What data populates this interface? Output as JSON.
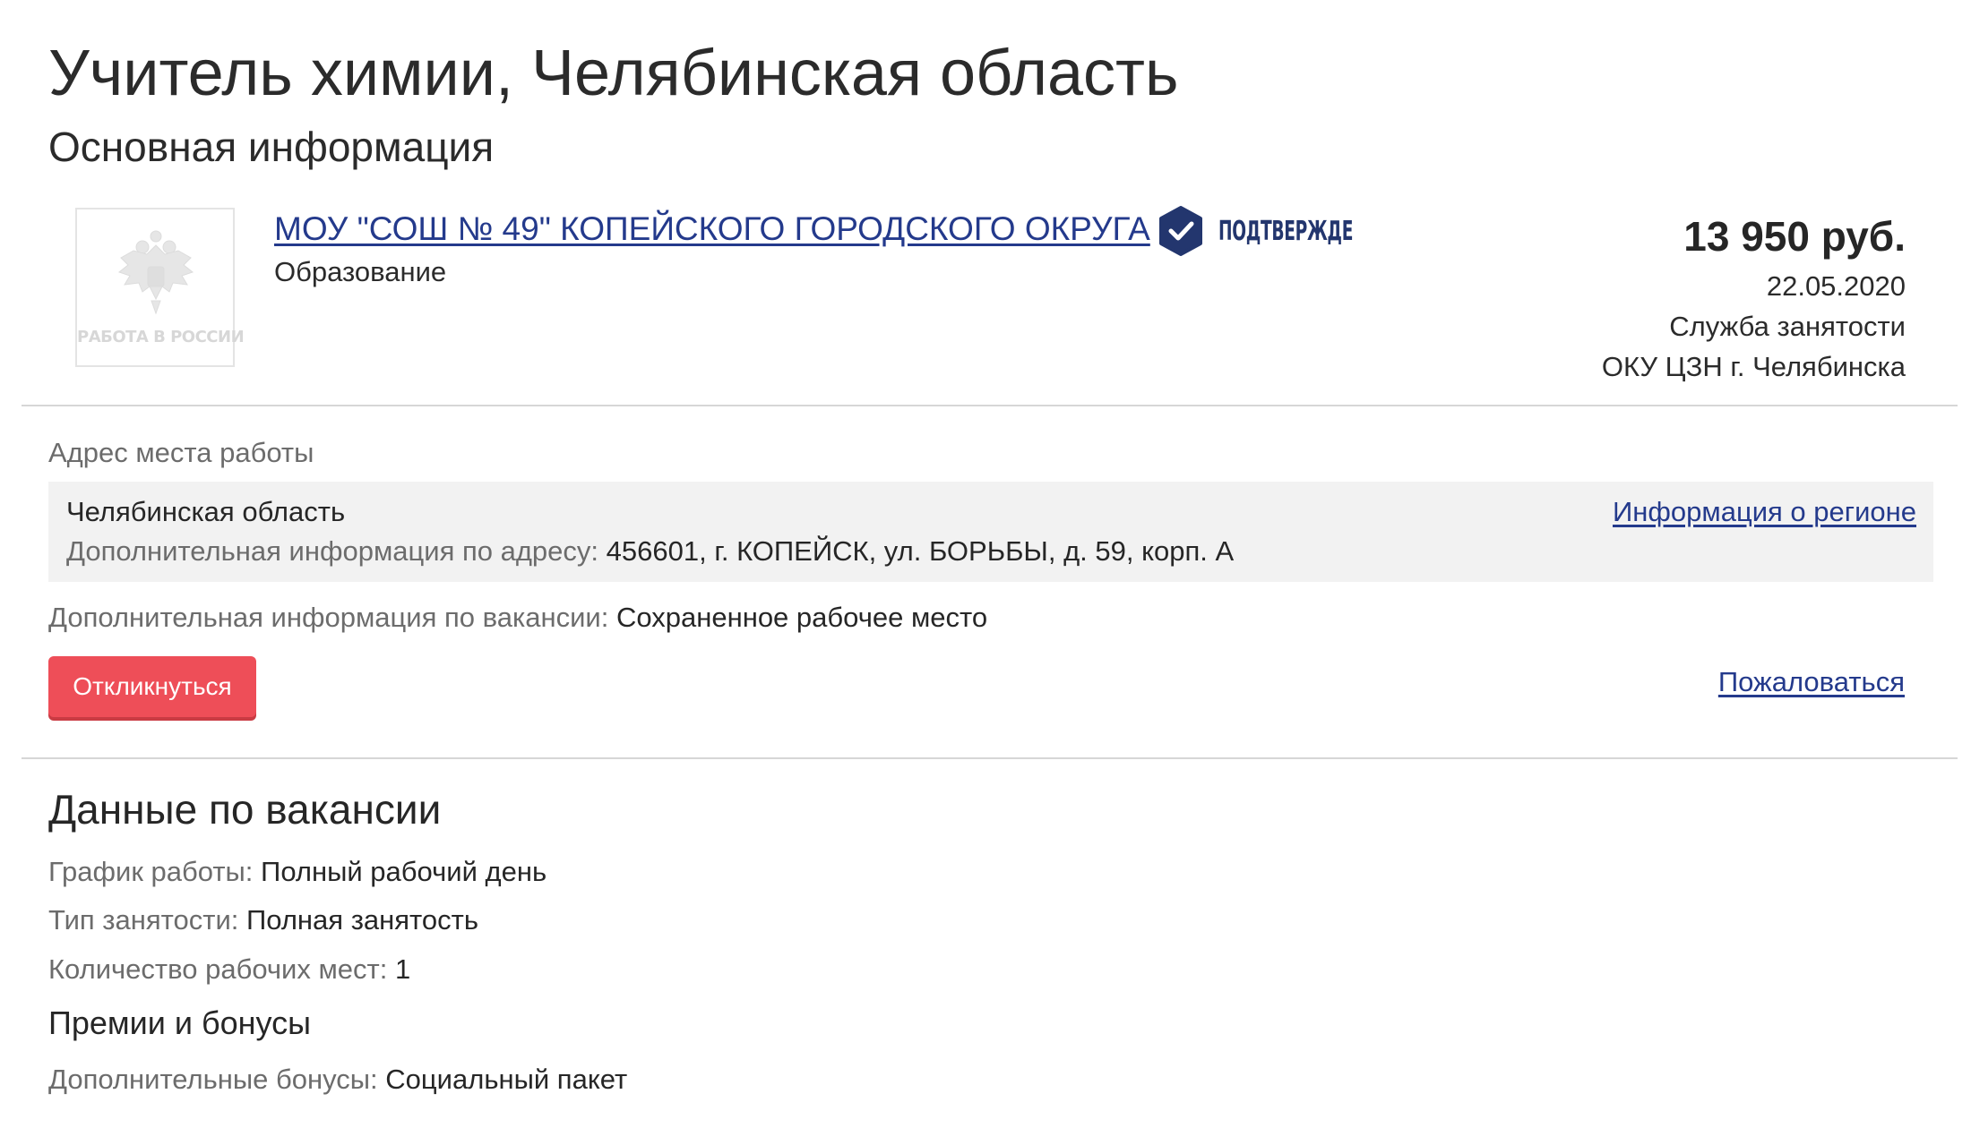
{
  "page": {
    "title": "Учитель химии, Челябинская область",
    "section_title": "Основная информация"
  },
  "employer": {
    "logo_text": "РАБОТА В РОССИИ",
    "name": "МОУ \"СОШ № 49\" КОПЕЙСКОГО ГОРОДСКОГО ОКРУГА",
    "verified_label": "ПОДТВЕРЖДЕ",
    "industry": "Образование"
  },
  "summary": {
    "salary": "13 950 руб.",
    "date": "22.05.2020",
    "source": "Служба занятости",
    "source_office": "ОКУ ЦЗН г. Челябинска"
  },
  "address": {
    "label": "Адрес места работы",
    "region": "Челябинская область",
    "extra_label": "Дополнительная информация по адресу:",
    "extra_value": "456601, г. КОПЕЙСК, ул. БОРЬБЫ, д. 59, корп. А",
    "region_link": "Информация о регионе"
  },
  "vacancy_extra": {
    "label": "Дополнительная информация по вакансии:",
    "value": "Сохраненное рабочее место"
  },
  "actions": {
    "respond_label": "Откликнуться",
    "complain_label": "Пожаловаться"
  },
  "vacancy_data": {
    "title": "Данные по вакансии",
    "rows": [
      {
        "label": "График работы:",
        "value": "Полный рабочий день"
      },
      {
        "label": "Тип занятости:",
        "value": "Полная занятость"
      },
      {
        "label": "Количество рабочих мест:",
        "value": "1"
      }
    ]
  },
  "bonuses": {
    "title": "Премии и бонусы",
    "label": "Дополнительные бонусы:",
    "value": "Социальный пакет"
  },
  "colors": {
    "link": "#243a8c",
    "button": "#ee4e58",
    "verified_badge": "#23366e",
    "label_gray": "#6c6c6c"
  }
}
